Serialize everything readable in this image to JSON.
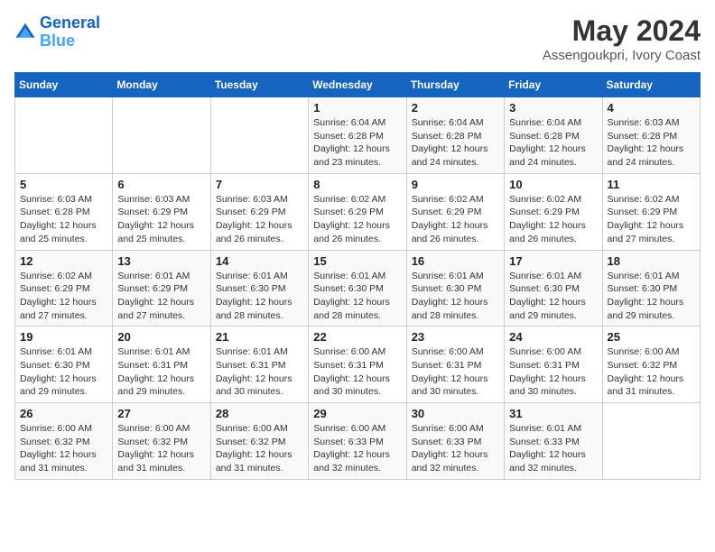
{
  "header": {
    "logo_line1": "General",
    "logo_line2": "Blue",
    "month_year": "May 2024",
    "location": "Assengoukpri, Ivory Coast"
  },
  "weekdays": [
    "Sunday",
    "Monday",
    "Tuesday",
    "Wednesday",
    "Thursday",
    "Friday",
    "Saturday"
  ],
  "weeks": [
    [
      {
        "day": "",
        "info": ""
      },
      {
        "day": "",
        "info": ""
      },
      {
        "day": "",
        "info": ""
      },
      {
        "day": "1",
        "info": "Sunrise: 6:04 AM\nSunset: 6:28 PM\nDaylight: 12 hours\nand 23 minutes."
      },
      {
        "day": "2",
        "info": "Sunrise: 6:04 AM\nSunset: 6:28 PM\nDaylight: 12 hours\nand 24 minutes."
      },
      {
        "day": "3",
        "info": "Sunrise: 6:04 AM\nSunset: 6:28 PM\nDaylight: 12 hours\nand 24 minutes."
      },
      {
        "day": "4",
        "info": "Sunrise: 6:03 AM\nSunset: 6:28 PM\nDaylight: 12 hours\nand 24 minutes."
      }
    ],
    [
      {
        "day": "5",
        "info": "Sunrise: 6:03 AM\nSunset: 6:28 PM\nDaylight: 12 hours\nand 25 minutes."
      },
      {
        "day": "6",
        "info": "Sunrise: 6:03 AM\nSunset: 6:29 PM\nDaylight: 12 hours\nand 25 minutes."
      },
      {
        "day": "7",
        "info": "Sunrise: 6:03 AM\nSunset: 6:29 PM\nDaylight: 12 hours\nand 26 minutes."
      },
      {
        "day": "8",
        "info": "Sunrise: 6:02 AM\nSunset: 6:29 PM\nDaylight: 12 hours\nand 26 minutes."
      },
      {
        "day": "9",
        "info": "Sunrise: 6:02 AM\nSunset: 6:29 PM\nDaylight: 12 hours\nand 26 minutes."
      },
      {
        "day": "10",
        "info": "Sunrise: 6:02 AM\nSunset: 6:29 PM\nDaylight: 12 hours\nand 26 minutes."
      },
      {
        "day": "11",
        "info": "Sunrise: 6:02 AM\nSunset: 6:29 PM\nDaylight: 12 hours\nand 27 minutes."
      }
    ],
    [
      {
        "day": "12",
        "info": "Sunrise: 6:02 AM\nSunset: 6:29 PM\nDaylight: 12 hours\nand 27 minutes."
      },
      {
        "day": "13",
        "info": "Sunrise: 6:01 AM\nSunset: 6:29 PM\nDaylight: 12 hours\nand 27 minutes."
      },
      {
        "day": "14",
        "info": "Sunrise: 6:01 AM\nSunset: 6:30 PM\nDaylight: 12 hours\nand 28 minutes."
      },
      {
        "day": "15",
        "info": "Sunrise: 6:01 AM\nSunset: 6:30 PM\nDaylight: 12 hours\nand 28 minutes."
      },
      {
        "day": "16",
        "info": "Sunrise: 6:01 AM\nSunset: 6:30 PM\nDaylight: 12 hours\nand 28 minutes."
      },
      {
        "day": "17",
        "info": "Sunrise: 6:01 AM\nSunset: 6:30 PM\nDaylight: 12 hours\nand 29 minutes."
      },
      {
        "day": "18",
        "info": "Sunrise: 6:01 AM\nSunset: 6:30 PM\nDaylight: 12 hours\nand 29 minutes."
      }
    ],
    [
      {
        "day": "19",
        "info": "Sunrise: 6:01 AM\nSunset: 6:30 PM\nDaylight: 12 hours\nand 29 minutes."
      },
      {
        "day": "20",
        "info": "Sunrise: 6:01 AM\nSunset: 6:31 PM\nDaylight: 12 hours\nand 29 minutes."
      },
      {
        "day": "21",
        "info": "Sunrise: 6:01 AM\nSunset: 6:31 PM\nDaylight: 12 hours\nand 30 minutes."
      },
      {
        "day": "22",
        "info": "Sunrise: 6:00 AM\nSunset: 6:31 PM\nDaylight: 12 hours\nand 30 minutes."
      },
      {
        "day": "23",
        "info": "Sunrise: 6:00 AM\nSunset: 6:31 PM\nDaylight: 12 hours\nand 30 minutes."
      },
      {
        "day": "24",
        "info": "Sunrise: 6:00 AM\nSunset: 6:31 PM\nDaylight: 12 hours\nand 30 minutes."
      },
      {
        "day": "25",
        "info": "Sunrise: 6:00 AM\nSunset: 6:32 PM\nDaylight: 12 hours\nand 31 minutes."
      }
    ],
    [
      {
        "day": "26",
        "info": "Sunrise: 6:00 AM\nSunset: 6:32 PM\nDaylight: 12 hours\nand 31 minutes."
      },
      {
        "day": "27",
        "info": "Sunrise: 6:00 AM\nSunset: 6:32 PM\nDaylight: 12 hours\nand 31 minutes."
      },
      {
        "day": "28",
        "info": "Sunrise: 6:00 AM\nSunset: 6:32 PM\nDaylight: 12 hours\nand 31 minutes."
      },
      {
        "day": "29",
        "info": "Sunrise: 6:00 AM\nSunset: 6:33 PM\nDaylight: 12 hours\nand 32 minutes."
      },
      {
        "day": "30",
        "info": "Sunrise: 6:00 AM\nSunset: 6:33 PM\nDaylight: 12 hours\nand 32 minutes."
      },
      {
        "day": "31",
        "info": "Sunrise: 6:01 AM\nSunset: 6:33 PM\nDaylight: 12 hours\nand 32 minutes."
      },
      {
        "day": "",
        "info": ""
      }
    ]
  ]
}
